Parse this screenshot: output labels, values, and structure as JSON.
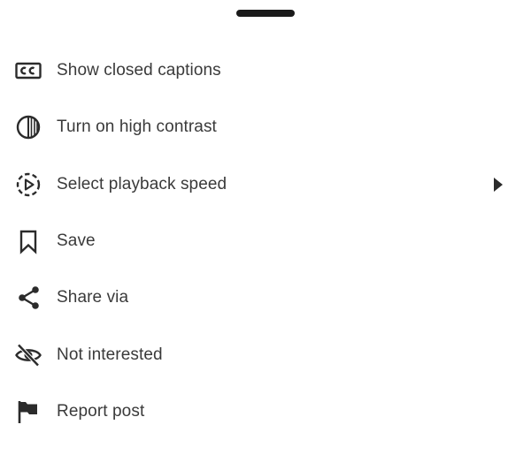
{
  "menu": {
    "items": [
      {
        "label": "Show closed captions",
        "icon": "closed-captions-icon"
      },
      {
        "label": "Turn on high contrast",
        "icon": "high-contrast-icon"
      },
      {
        "label": "Select playback speed",
        "icon": "playback-speed-icon",
        "submenu_indicator": "chevron-right-icon"
      },
      {
        "label": "Save",
        "icon": "bookmark-icon"
      },
      {
        "label": "Share via",
        "icon": "share-icon"
      },
      {
        "label": "Not interested",
        "icon": "eye-off-icon"
      },
      {
        "label": "Report post",
        "icon": "flag-icon"
      }
    ]
  },
  "colors": {
    "background": "#ffffff",
    "text": "#3a3a3a",
    "icon": "#2b2b2b",
    "handle": "#1a1a1a"
  }
}
